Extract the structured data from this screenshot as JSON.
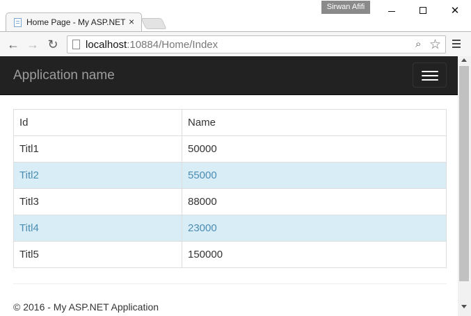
{
  "browser": {
    "user_name": "Sirwan Afifi",
    "tab_title": "Home Page - My ASP.NET",
    "tab_close": "×",
    "url_host": "localhost",
    "url_rest": ":10884/Home/Index",
    "icons": {
      "back": "←",
      "forward": "→",
      "reload": "↻",
      "zoom": "⌕",
      "star": "☆",
      "close": "✕"
    }
  },
  "navbar": {
    "brand": "Application name"
  },
  "table": {
    "headers": [
      "Id",
      "Name"
    ],
    "rows": [
      {
        "id": "Titl1",
        "name": "50000",
        "highlighted": false
      },
      {
        "id": "Titl2",
        "name": "55000",
        "highlighted": true
      },
      {
        "id": "Titl3",
        "name": "88000",
        "highlighted": false
      },
      {
        "id": "Titl4",
        "name": "23000",
        "highlighted": true
      },
      {
        "id": "Titl5",
        "name": "150000",
        "highlighted": false
      }
    ]
  },
  "footer": {
    "text": "© 2016 - My ASP.NET Application"
  },
  "colors": {
    "navbar_bg": "#222222",
    "brand_text": "#9d9d9d",
    "info_row_bg": "#d9edf7",
    "info_row_text": "#4b8cb1"
  }
}
